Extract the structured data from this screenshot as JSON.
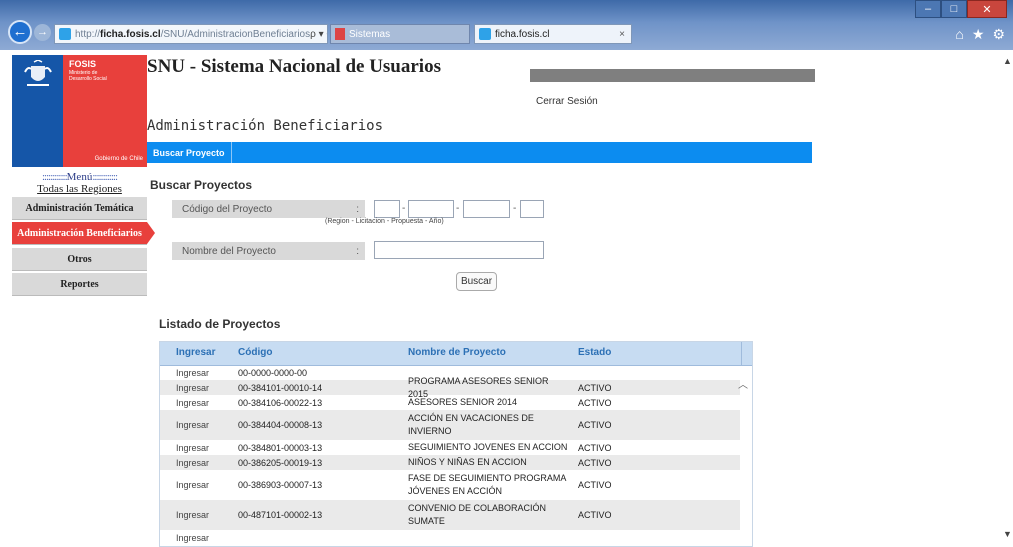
{
  "browser": {
    "url_prefix": "http://",
    "url_host": "ficha.fosis.cl",
    "url_path": "/SNU/AdministracionBeneficiarios",
    "address_tools": "ρ ▾ C",
    "tabs": [
      {
        "label": "Sistemas"
      },
      {
        "label": "ficha.fosis.cl",
        "close": "×"
      }
    ],
    "toolbar_icons": [
      "home-icon",
      "star-icon",
      "gear-icon"
    ]
  },
  "logo": {
    "title": "FOSIS",
    "subtitle_1": "Ministerio de",
    "subtitle_2": "Desarrollo Social",
    "footer": "Gobierno de Chile"
  },
  "sidebar": {
    "menu_title": "Menú",
    "menu_dots": "::::::::::::",
    "regions_link": "Todas las Regiones",
    "items": [
      {
        "label": "Administración Temática",
        "active": false
      },
      {
        "label": "Administración Beneficiarios",
        "active": true
      },
      {
        "label": "Otros",
        "active": false
      },
      {
        "label": "Reportes",
        "active": false
      }
    ]
  },
  "header": {
    "site_title": "SNU - Sistema Nacional de Usuarios",
    "logout": "Cerrar Sesión"
  },
  "main": {
    "section_title": "Administración Beneficiarios",
    "tab_label": "Buscar Proyecto",
    "search_title": "Buscar Proyectos",
    "code_label": "Código del Proyecto",
    "code_hint": "(Region -   Licitacion   -   Propuesta   -   Año)",
    "name_label": "Nombre del Proyecto",
    "colon": ":",
    "dash": "-",
    "search_button": "Buscar",
    "code_values": [
      "",
      "",
      "",
      ""
    ],
    "name_value": ""
  },
  "list": {
    "title": "Listado de Proyectos",
    "columns": [
      "Ingresar",
      "Código",
      "Nombre de Proyecto",
      "Estado"
    ],
    "rows": [
      {
        "ingresar": "Ingresar",
        "codigo": "00-0000-0000-00",
        "nombre": "",
        "estado": ""
      },
      {
        "ingresar": "Ingresar",
        "codigo": "00-384101-00010-14",
        "nombre": "PROGRAMA ASESORES SENIOR 2015",
        "estado": "ACTIVO"
      },
      {
        "ingresar": "Ingresar",
        "codigo": "00-384106-00022-13",
        "nombre": "ASESORES SENIOR 2014",
        "estado": "ACTIVO"
      },
      {
        "ingresar": "Ingresar",
        "codigo": "00-384404-00008-13",
        "nombre": "ACCIÓN EN VACACIONES DE INVIERNO",
        "estado": "ACTIVO"
      },
      {
        "ingresar": "Ingresar",
        "codigo": "00-384801-00003-13",
        "nombre": "SEGUIMIENTO JOVENES EN ACCION",
        "estado": "ACTIVO"
      },
      {
        "ingresar": "Ingresar",
        "codigo": "00-386205-00019-13",
        "nombre": "NIÑOS Y NIÑAS EN ACCION",
        "estado": "ACTIVO"
      },
      {
        "ingresar": "Ingresar",
        "codigo": "00-386903-00007-13",
        "nombre": "FASE DE SEGUIMIENTO PROGRAMA JÓVENES EN ACCIÓN",
        "estado": "ACTIVO"
      },
      {
        "ingresar": "Ingresar",
        "codigo": "00-487101-00002-13",
        "nombre": "CONVENIO DE COLABORACIÓN SUMATE",
        "estado": "ACTIVO"
      },
      {
        "ingresar": "Ingresar",
        "codigo": "",
        "nombre": "",
        "estado": ""
      }
    ]
  },
  "colors": {
    "accent_blue": "#0c8cf0",
    "accent_red": "#e8403c",
    "logo_blue": "#1556a8",
    "header_text": "#2c70b5"
  }
}
